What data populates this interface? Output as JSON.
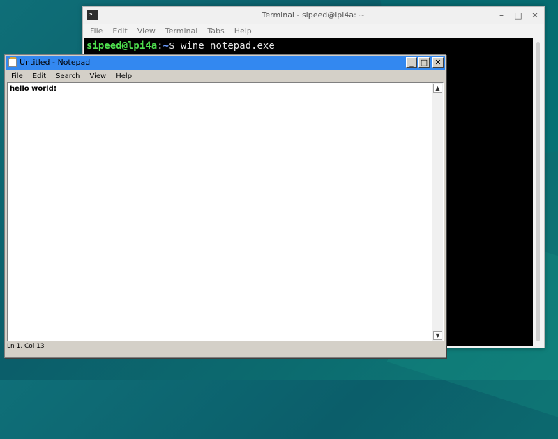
{
  "terminal": {
    "title": "Terminal - sipeed@lpi4a: ~",
    "icon": ">_",
    "controls": {
      "minimize": "–",
      "maximize": "□",
      "close": "✕"
    },
    "menu": [
      "File",
      "Edit",
      "View",
      "Terminal",
      "Tabs",
      "Help"
    ],
    "prompt_user": "sipeed@lpi4a",
    "prompt_sep": ":",
    "prompt_path": "~",
    "prompt_symbol": "$",
    "command": "wine notepad.exe"
  },
  "notepad": {
    "title": "Untitled - Notepad",
    "controls": {
      "minimize": "_",
      "maximize": "□",
      "close": "✕"
    },
    "menu": [
      "File",
      "Edit",
      "Search",
      "View",
      "Help"
    ],
    "text": "hello world!",
    "status": "Ln 1, Col 13",
    "scroll_up": "▲",
    "scroll_down": "▼"
  }
}
